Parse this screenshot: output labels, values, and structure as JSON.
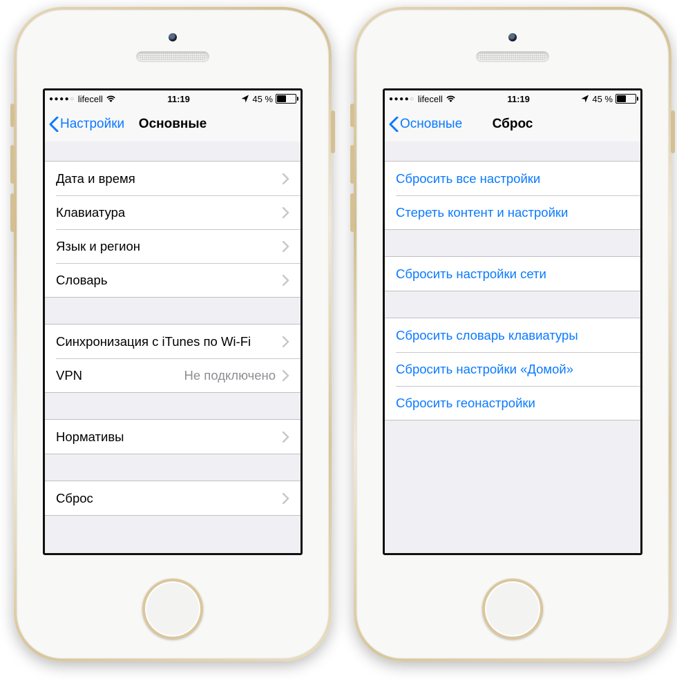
{
  "status": {
    "carrier": "lifecell",
    "time": "11:19",
    "battery_text": "45 %"
  },
  "left": {
    "nav_back": "Настройки",
    "nav_title": "Основные",
    "groups": [
      {
        "rows": [
          {
            "label": "Дата и время"
          },
          {
            "label": "Клавиатура"
          },
          {
            "label": "Язык и регион"
          },
          {
            "label": "Словарь"
          }
        ]
      },
      {
        "rows": [
          {
            "label": "Синхронизация с iTunes по Wi-Fi"
          },
          {
            "label": "VPN",
            "detail": "Не подключено"
          }
        ]
      },
      {
        "rows": [
          {
            "label": "Нормативы"
          }
        ]
      },
      {
        "rows": [
          {
            "label": "Сброс"
          }
        ]
      }
    ]
  },
  "right": {
    "nav_back": "Основные",
    "nav_title": "Сброс",
    "groups": [
      {
        "rows": [
          {
            "label": "Сбросить все настройки"
          },
          {
            "label": "Стереть контент и настройки"
          }
        ]
      },
      {
        "rows": [
          {
            "label": "Сбросить настройки сети"
          }
        ]
      },
      {
        "rows": [
          {
            "label": "Сбросить словарь клавиатуры"
          },
          {
            "label": "Сбросить настройки «Домой»"
          },
          {
            "label": "Сбросить геонастройки"
          }
        ]
      }
    ]
  }
}
